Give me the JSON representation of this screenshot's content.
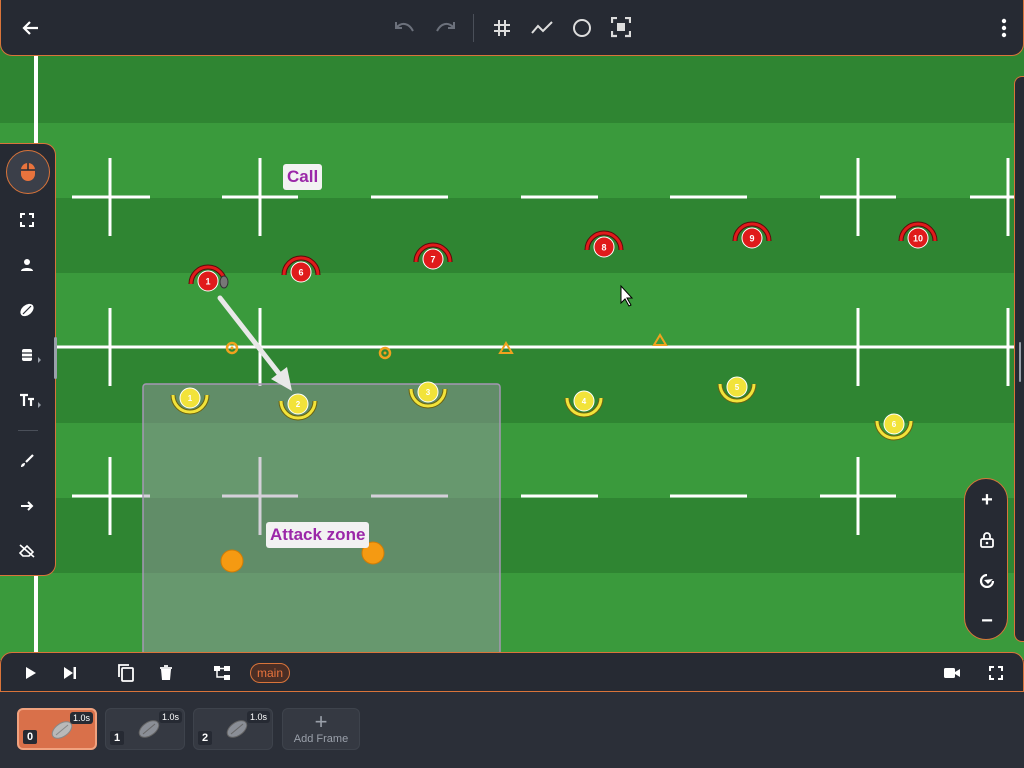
{
  "toolbar": {
    "back": "arrow-left-icon",
    "undo": "undo-icon",
    "redo": "redo-icon",
    "grid": "grid-icon",
    "path": "path-icon",
    "circle": "circle-icon",
    "fit": "fit-screen-icon",
    "menu": "more-vertical-icon"
  },
  "left_tools": [
    {
      "name": "mouse-icon",
      "active": true
    },
    {
      "name": "select-area-icon"
    },
    {
      "name": "player-icon"
    },
    {
      "name": "ball-icon"
    },
    {
      "name": "equipment-icon"
    },
    {
      "name": "text-icon"
    },
    {
      "name": "brush-icon"
    },
    {
      "name": "arrow-tool-icon"
    },
    {
      "name": "eraser-icon"
    }
  ],
  "pitch": {
    "labels": {
      "call": "Call",
      "attack_zone": "Attack zone"
    },
    "red_players": [
      "1",
      "6",
      "7",
      "8",
      "9",
      "10"
    ],
    "yellow_players": [
      "1",
      "2",
      "3",
      "4",
      "5",
      "6"
    ],
    "colors": {
      "grass_light": "#3a9a3c",
      "grass_dark": "#2f8532",
      "red_team": "#e01b1b",
      "yellow_team": "#f2e33a",
      "cone": "#f0a21e",
      "accent": "#d9743a",
      "label_text": "#9b27a8"
    }
  },
  "zoom": {
    "in": "+",
    "lock": "lock-icon",
    "reset": "reset-view-icon",
    "out": "−"
  },
  "controls": {
    "play": "play-icon",
    "step": "skip-next-icon",
    "copy": "copy-icon",
    "delete": "trash-icon",
    "tree": "tree-icon",
    "branch": "main",
    "camera": "camera-icon",
    "fullscreen": "fullscreen-icon"
  },
  "frames": [
    {
      "num": "0",
      "duration": "1.0s",
      "selected": true
    },
    {
      "num": "1",
      "duration": "1.0s",
      "selected": false
    },
    {
      "num": "2",
      "duration": "1.0s",
      "selected": false
    }
  ],
  "add_frame": {
    "plus": "+",
    "label": "Add Frame"
  }
}
